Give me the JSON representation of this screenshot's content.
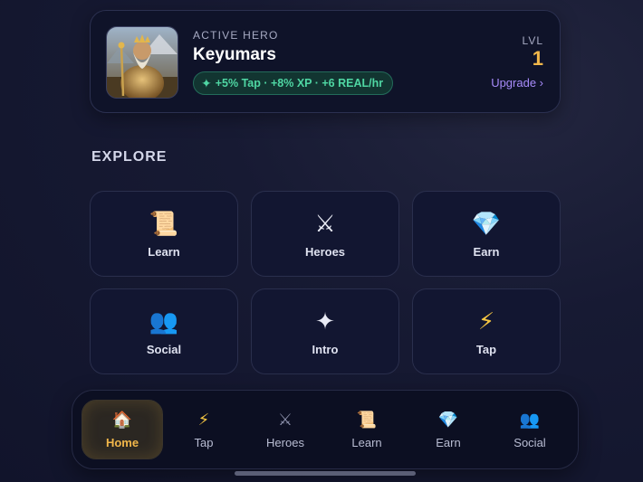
{
  "hero": {
    "eyebrow": "ACTIVE HERO",
    "name": "Keyumars",
    "perks": "+5% Tap · +8% XP · +6 REAL/hr",
    "perk_icon": "sparkle-icon",
    "level_label": "LVL",
    "level_value": "1",
    "upgrade_label": "Upgrade ›"
  },
  "explore": {
    "title": "EXPLORE",
    "tiles": [
      {
        "label": "Learn",
        "icon": "scroll-icon",
        "glyph": "📜"
      },
      {
        "label": "Heroes",
        "icon": "crossed-swords-icon",
        "glyph": "⚔"
      },
      {
        "label": "Earn",
        "icon": "gem-icon",
        "glyph": "💎"
      },
      {
        "label": "Social",
        "icon": "people-icon",
        "glyph": "👥"
      },
      {
        "label": "Intro",
        "icon": "sparkle-icon",
        "glyph": "✦"
      },
      {
        "label": "Tap",
        "icon": "lightning-icon",
        "glyph": "⚡"
      }
    ]
  },
  "nav": {
    "items": [
      {
        "label": "Home",
        "icon": "house-icon",
        "glyph": "🏠",
        "active": true
      },
      {
        "label": "Tap",
        "icon": "lightning-icon",
        "glyph": "⚡",
        "active": false
      },
      {
        "label": "Heroes",
        "icon": "crossed-swords-icon",
        "glyph": "⚔",
        "active": false
      },
      {
        "label": "Learn",
        "icon": "scroll-icon",
        "glyph": "📜",
        "active": false
      },
      {
        "label": "Earn",
        "icon": "gem-icon",
        "glyph": "💎",
        "active": false
      },
      {
        "label": "Social",
        "icon": "people-icon",
        "glyph": "👥",
        "active": false
      }
    ]
  },
  "colors": {
    "accent_gold": "#f1b74a",
    "accent_green": "#4fd6a3",
    "accent_purple": "#a78bfa",
    "background": "#151833"
  }
}
